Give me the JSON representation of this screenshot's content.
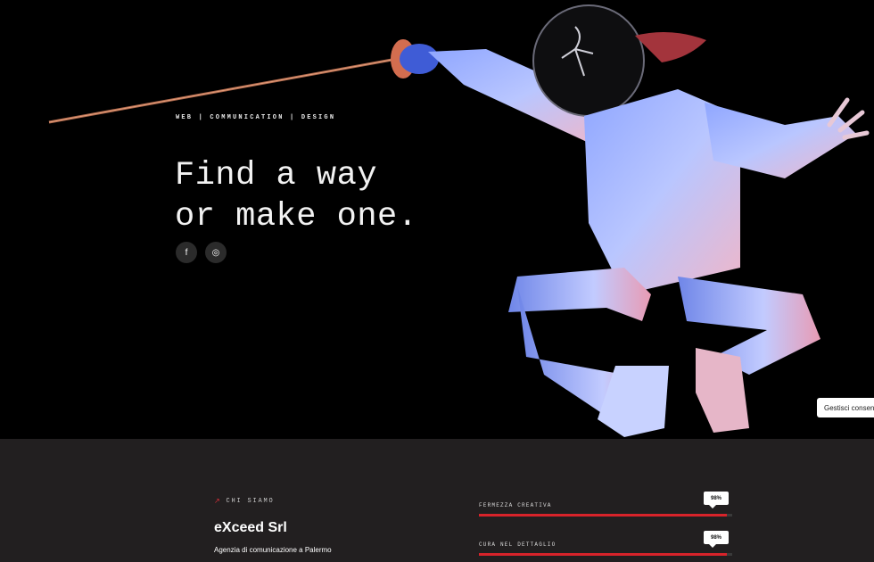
{
  "hero": {
    "tagline": "WEB | COMMUNICATION | DESIGN",
    "headline_line1": "Find a way",
    "headline_line2": "or make one.",
    "social": [
      {
        "icon": "facebook-icon",
        "glyph": "f"
      },
      {
        "icon": "instagram-icon",
        "glyph": "◎"
      }
    ]
  },
  "consent": {
    "label": "Gestisci consen"
  },
  "about": {
    "eyebrow": "CHI SIAMO",
    "company": "eXceed Srl",
    "subtitle": "Agenzia di comunicazione a Palermo",
    "skills": [
      {
        "label": "FERMEZZA CREATIVA",
        "percent_label": "98%",
        "percent": 98
      },
      {
        "label": "CURA NEL DETTAGLIO",
        "percent_label": "98%",
        "percent": 98
      }
    ]
  },
  "colors": {
    "accent": "#d8232a",
    "background": "#000000",
    "section_bg": "#221f20"
  }
}
